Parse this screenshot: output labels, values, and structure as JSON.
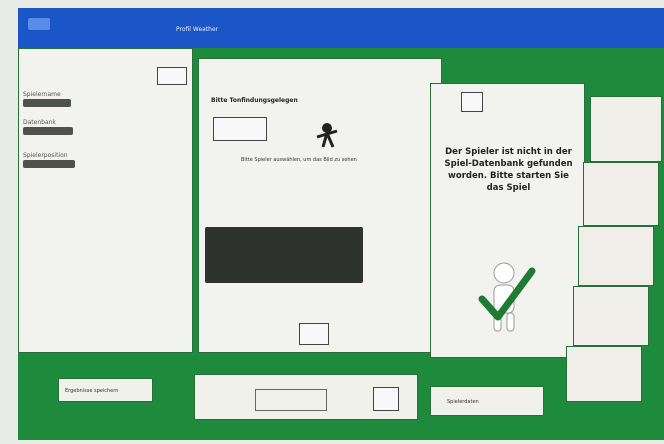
{
  "window": {
    "title": "Profil Weather",
    "accent": "#1b56c9",
    "background": "#1d8a3c"
  },
  "left_panel": {
    "fields": [
      {
        "label": "Spielername"
      },
      {
        "label": "Datenbank"
      },
      {
        "label": "Spielerposition"
      }
    ]
  },
  "center_panel": {
    "title": "Bitte Tonfindungsgelegen",
    "caption": "Bitte Spieler auswählen, um das Bild zu sehen"
  },
  "right_panel": {
    "message": "Der Spieler ist nicht in der Spiel-Datenbank gefunden worden. Bitte starten Sie das Spiel",
    "icon": "checkmark-figure-icon",
    "check_color": "#1f7a33"
  },
  "bottom": {
    "left_label": "Ergebnisse speichern",
    "right_label": "Spielerdaten"
  }
}
